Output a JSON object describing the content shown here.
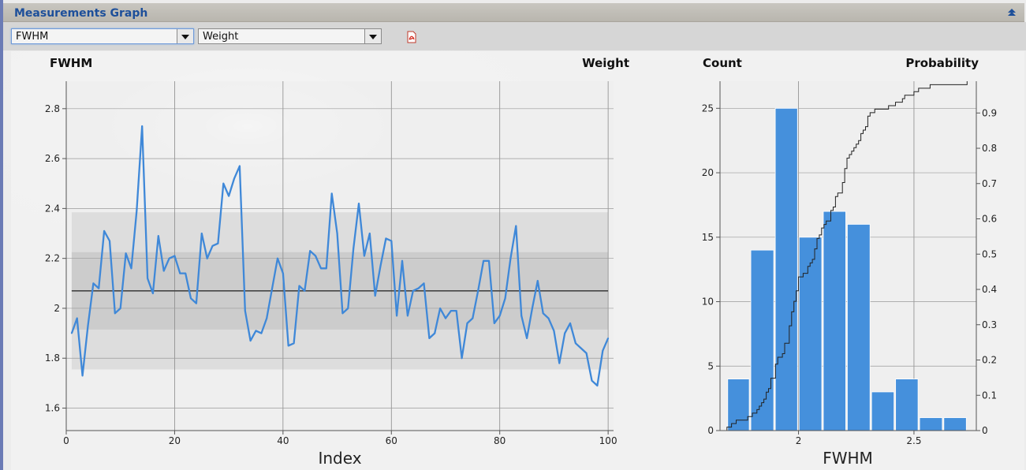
{
  "header": {
    "title": "Measurements Graph"
  },
  "toolbar": {
    "x_select": "FWHM",
    "y_select": "Weight"
  },
  "line_chart_labels": {
    "left_title": "FWHM",
    "right_title": "Weight",
    "xlabel": "Index"
  },
  "hist_chart_labels": {
    "left_title": "Count",
    "right_title": "Probability",
    "xlabel": "FWHM"
  },
  "colors": {
    "series": "#3f88d8",
    "band_outer": "#d9d9d9",
    "band_inner": "#c9c9c9",
    "mean_line": "#444444",
    "title": "#1d4f9a"
  },
  "chart_data": [
    {
      "type": "line",
      "xlabel": "Index",
      "ylabel": "FWHM",
      "xlim": [
        0,
        101
      ],
      "ylim": [
        1.51,
        2.91
      ],
      "xticks": [
        0,
        20,
        40,
        60,
        80,
        100
      ],
      "yticks": [
        1.6,
        1.8,
        2,
        2.2,
        2.4,
        2.6,
        2.8
      ],
      "ytick_labels": [
        "1.6",
        "1.8",
        "2",
        "2.2",
        "2.4",
        "2.6",
        "2.8"
      ],
      "grid": true,
      "mean": 2.07,
      "band_inner": [
        1.915,
        2.225
      ],
      "band_outer": [
        1.755,
        2.385
      ],
      "x": [
        1,
        2,
        3,
        4,
        5,
        6,
        7,
        8,
        9,
        10,
        11,
        12,
        13,
        14,
        15,
        16,
        17,
        18,
        19,
        20,
        21,
        22,
        23,
        24,
        25,
        26,
        27,
        28,
        29,
        30,
        31,
        32,
        33,
        34,
        35,
        36,
        37,
        38,
        39,
        40,
        41,
        42,
        43,
        44,
        45,
        46,
        47,
        48,
        49,
        50,
        51,
        52,
        53,
        54,
        55,
        56,
        57,
        58,
        59,
        60,
        61,
        62,
        63,
        64,
        65,
        66,
        67,
        68,
        69,
        70,
        71,
        72,
        73,
        74,
        75,
        76,
        77,
        78,
        79,
        80,
        81,
        82,
        83,
        84,
        85,
        86,
        87,
        88,
        89,
        90,
        91,
        92,
        93,
        94,
        95,
        96,
        97,
        98,
        99,
        100
      ],
      "series": [
        {
          "values": [
            1.9,
            1.96,
            1.73,
            1.93,
            2.1,
            2.08,
            2.31,
            2.27,
            1.98,
            2.0,
            2.22,
            2.16,
            2.39,
            2.73,
            2.12,
            2.06,
            2.29,
            2.15,
            2.2,
            2.21,
            2.14,
            2.14,
            2.04,
            2.02,
            2.3,
            2.2,
            2.25,
            2.26,
            2.5,
            2.45,
            2.52,
            2.57,
            1.99,
            1.87,
            1.91,
            1.9,
            1.96,
            2.08,
            2.2,
            2.14,
            1.85,
            1.86,
            2.09,
            2.07,
            2.23,
            2.21,
            2.16,
            2.16,
            2.46,
            2.3,
            1.98,
            2.0,
            2.24,
            2.42,
            2.21,
            2.3,
            2.05,
            2.17,
            2.28,
            2.27,
            1.97,
            2.19,
            1.97,
            2.07,
            2.08,
            2.1,
            1.88,
            1.9,
            2.0,
            1.96,
            1.99,
            1.99,
            1.8,
            1.94,
            1.96,
            2.07,
            2.19,
            2.19,
            1.94,
            1.97,
            2.04,
            2.2,
            2.33,
            1.97,
            1.88,
            2.0,
            2.11,
            1.98,
            1.96,
            1.91,
            1.78,
            1.9,
            1.94,
            1.86,
            1.84,
            1.82,
            1.71,
            1.69,
            1.83,
            1.88
          ]
        }
      ]
    },
    {
      "type": "bar",
      "subtype": "histogram-with-cdf",
      "xlabel": "FWHM",
      "ylabel": "Count",
      "y2label": "Probability",
      "xlim": [
        1.66,
        2.77
      ],
      "ylim": [
        0,
        27.1
      ],
      "y2lim": [
        0,
        0.99
      ],
      "xticks": [
        2,
        2.5
      ],
      "xtick_labels": [
        "2",
        "2.5"
      ],
      "yticks": [
        0,
        5,
        10,
        15,
        20,
        25
      ],
      "y2ticks": [
        0,
        0.1,
        0.2,
        0.3,
        0.4,
        0.5,
        0.6,
        0.7,
        0.8,
        0.9
      ],
      "y2tick_labels": [
        "0",
        "0.1",
        "0.2",
        "0.3",
        "0.4",
        "0.5",
        "0.6",
        "0.7",
        "0.8",
        "0.9"
      ],
      "bins": [
        [
          1.69,
          1.79
        ],
        [
          1.79,
          1.896
        ],
        [
          1.896,
          1.999
        ],
        [
          1.999,
          2.104
        ],
        [
          2.104,
          2.208
        ],
        [
          2.208,
          2.313
        ],
        [
          2.313,
          2.417
        ],
        [
          2.417,
          2.521
        ],
        [
          2.521,
          2.626
        ],
        [
          2.626,
          2.73
        ]
      ],
      "values": [
        4,
        14,
        25,
        15,
        17,
        16,
        3,
        4,
        1,
        1
      ]
    }
  ]
}
